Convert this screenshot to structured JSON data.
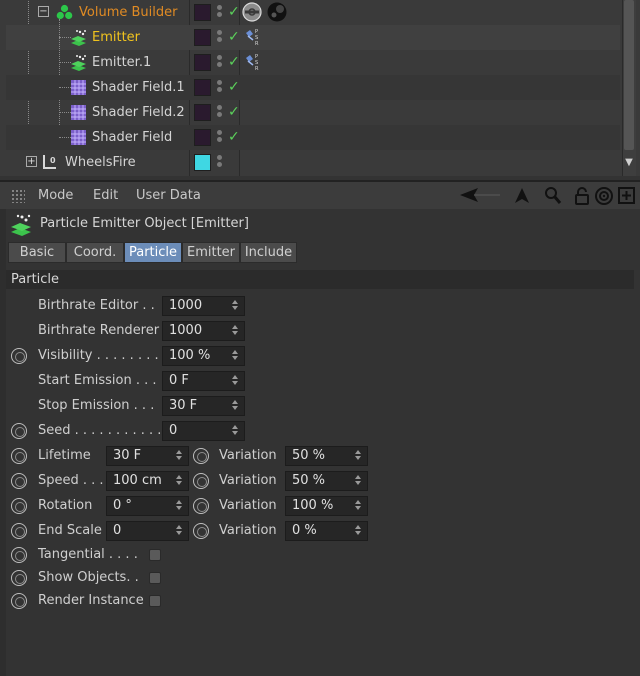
{
  "colors": {
    "panel_bg": "#333333",
    "tree_bg": "#3a3a3a",
    "accent_tab": "#6c8db9",
    "volume_builder_text": "#e08b24",
    "selected_text": "#f0c31e",
    "check": "#5bd25b",
    "wheelsfire_layer": "#3fd7e3"
  },
  "tree": {
    "items": [
      {
        "name": "Volume Builder",
        "icon": "volume-builder-icon",
        "state": "expanded"
      },
      {
        "name": "Emitter",
        "icon": "emitter-icon",
        "selected": true
      },
      {
        "name": "Emitter.1",
        "icon": "emitter-icon"
      },
      {
        "name": "Shader Field.1",
        "icon": "shader-field-icon"
      },
      {
        "name": "Shader Field.2",
        "icon": "shader-field-icon"
      },
      {
        "name": "Shader Field",
        "icon": "shader-field-icon"
      },
      {
        "name": "WheelsFire",
        "icon": "null-object-icon",
        "state": "collapsed"
      }
    ]
  },
  "menubar": {
    "mode": "Mode",
    "edit": "Edit",
    "user_data": "User Data"
  },
  "object": {
    "title": "Particle Emitter Object [Emitter]"
  },
  "tabs": [
    {
      "label": "Basic"
    },
    {
      "label": "Coord."
    },
    {
      "label": "Particle",
      "active": true
    },
    {
      "label": "Emitter"
    },
    {
      "label": "Include"
    }
  ],
  "section": {
    "title": "Particle"
  },
  "params": {
    "birthrate_editor": {
      "label": "Birthrate Editor . .",
      "value": "1000"
    },
    "birthrate_renderer": {
      "label": "Birthrate Renderer",
      "value": "1000"
    },
    "visibility": {
      "label": "Visibility . . . . . . . .",
      "value": "100 %"
    },
    "start_emission": {
      "label": "Start Emission . . .",
      "value": "0 F"
    },
    "stop_emission": {
      "label": "Stop Emission . . .",
      "value": "30 F"
    },
    "seed": {
      "label": "Seed . . . . . . . . . . .",
      "value": "0"
    },
    "lifetime": {
      "label": "Lifetime",
      "value": "30 F",
      "variation_label": "Variation",
      "variation": "50 %"
    },
    "speed": {
      "label": "Speed . . .",
      "value": "100 cm",
      "variation_label": "Variation",
      "variation": "50 %"
    },
    "rotation": {
      "label": "Rotation",
      "value": "0 °",
      "variation_label": "Variation",
      "variation": "100 %"
    },
    "end_scale": {
      "label": "End Scale",
      "value": "0",
      "variation_label": "Variation",
      "variation": "0 %"
    },
    "tangential": {
      "label": "Tangential . . . .",
      "checked": false
    },
    "show_objects": {
      "label": "Show Objects. .",
      "checked": false
    },
    "render_instance": {
      "label": "Render Instance",
      "checked": false
    }
  }
}
